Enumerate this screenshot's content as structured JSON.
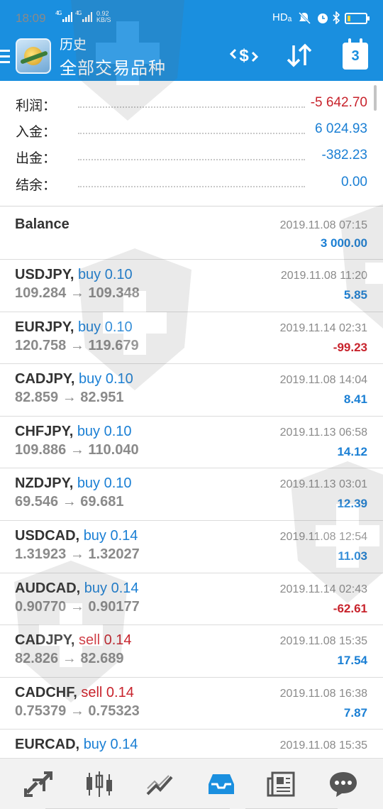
{
  "status_bar": {
    "time": "18:09",
    "signal1": "4G",
    "signal2": "4G",
    "net_speed_value": "0.92",
    "net_speed_unit": "KB/S",
    "hd_label": "HDₐ",
    "battery_level": 0.15
  },
  "app_bar": {
    "title": "历史",
    "subtitle": "全部交易品种",
    "calendar_day": "3",
    "icons": [
      "menu-icon",
      "app-logo-icon",
      "dollar-exchange-icon",
      "sort-arrows-icon",
      "calendar-icon"
    ]
  },
  "summary": {
    "profit_label": "利润：",
    "profit_value": "-5 642.70",
    "deposit_label": "入金：",
    "deposit_value": "6 024.93",
    "withdrawal_label": "出金：",
    "withdrawal_value": "-382.23",
    "balance_label": "结余：",
    "balance_value": "0.00"
  },
  "balance_entry": {
    "label": "Balance",
    "time": "2019.11.08 07:15",
    "amount": "3 000.00"
  },
  "deals": [
    {
      "symbol": "USDJPY,",
      "type": "buy",
      "volume": "0.10",
      "prices": "109.284 → 109.348",
      "time": "2019.11.08 11:20",
      "profit": "5.85"
    },
    {
      "symbol": "EURJPY,",
      "type": "buy",
      "volume": "0.10",
      "prices": "120.758 → 119.679",
      "time": "2019.11.14 02:31",
      "profit": "-99.23"
    },
    {
      "symbol": "CADJPY,",
      "type": "buy",
      "volume": "0.10",
      "prices": "82.859 → 82.951",
      "time": "2019.11.08 14:04",
      "profit": "8.41"
    },
    {
      "symbol": "CHFJPY,",
      "type": "buy",
      "volume": "0.10",
      "prices": "109.886 → 110.040",
      "time": "2019.11.13 06:58",
      "profit": "14.12"
    },
    {
      "symbol": "NZDJPY,",
      "type": "buy",
      "volume": "0.10",
      "prices": "69.546 → 69.681",
      "time": "2019.11.13 03:01",
      "profit": "12.39"
    },
    {
      "symbol": "USDCAD,",
      "type": "buy",
      "volume": "0.14",
      "prices": "1.31923 → 1.32027",
      "time": "2019.11.08 12:54",
      "profit": "11.03"
    },
    {
      "symbol": "AUDCAD,",
      "type": "buy",
      "volume": "0.14",
      "prices": "0.90770 → 0.90177",
      "time": "2019.11.14 02:43",
      "profit": "-62.61"
    },
    {
      "symbol": "CADJPY,",
      "type": "sell",
      "volume": "0.14",
      "prices": "82.826 → 82.689",
      "time": "2019.11.08 15:35",
      "profit": "17.54"
    },
    {
      "symbol": "CADCHF,",
      "type": "sell",
      "volume": "0.14",
      "prices": "0.75379 → 0.75323",
      "time": "2019.11.08 16:38",
      "profit": "7.87"
    },
    {
      "symbol": "EURCAD,",
      "type": "buy",
      "volume": "0.14",
      "prices": "",
      "time": "2019.11.08 15:35",
      "profit": ""
    }
  ],
  "bottom_nav": [
    {
      "name": "quotes-icon",
      "active": false
    },
    {
      "name": "chart-icon",
      "active": false
    },
    {
      "name": "trade-icon",
      "active": false
    },
    {
      "name": "history-icon",
      "active": true
    },
    {
      "name": "news-icon",
      "active": false
    },
    {
      "name": "chat-icon",
      "active": false
    }
  ],
  "colors": {
    "accent": "#1a8fdf",
    "buy": "#1a7fd4",
    "sell": "#c8232c",
    "profit_positive": "#1a7fd4",
    "profit_negative": "#c8232c",
    "muted": "#8a8a8a"
  }
}
